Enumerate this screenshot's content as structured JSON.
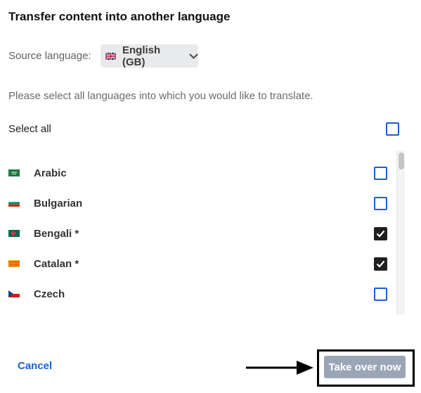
{
  "dialog": {
    "title": "Transfer content into another language",
    "source_label": "Source language:",
    "source_value": "English (GB)",
    "source_flag": "flag-gb-icon",
    "instruction": "Please select all languages into which you would like to translate.",
    "select_all_label": "Select all",
    "select_all_checked": false
  },
  "languages": [
    {
      "name": "Arabic",
      "flag": "flag-sa-icon",
      "checked": false
    },
    {
      "name": "Bulgarian",
      "flag": "flag-bg-icon",
      "checked": false
    },
    {
      "name": "Bengali *",
      "flag": "flag-bd-icon",
      "checked": true
    },
    {
      "name": "Catalan *",
      "flag": "flag-catalonia-icon",
      "checked": true
    },
    {
      "name": "Czech",
      "flag": "flag-cz-icon",
      "checked": false
    }
  ],
  "footer": {
    "cancel_label": "Cancel",
    "takeover_label": "Take over now"
  },
  "colors": {
    "accent": "#1a5fd6",
    "button_disabled": "#9aa6b6",
    "checked_fill": "#1f1f1f"
  }
}
